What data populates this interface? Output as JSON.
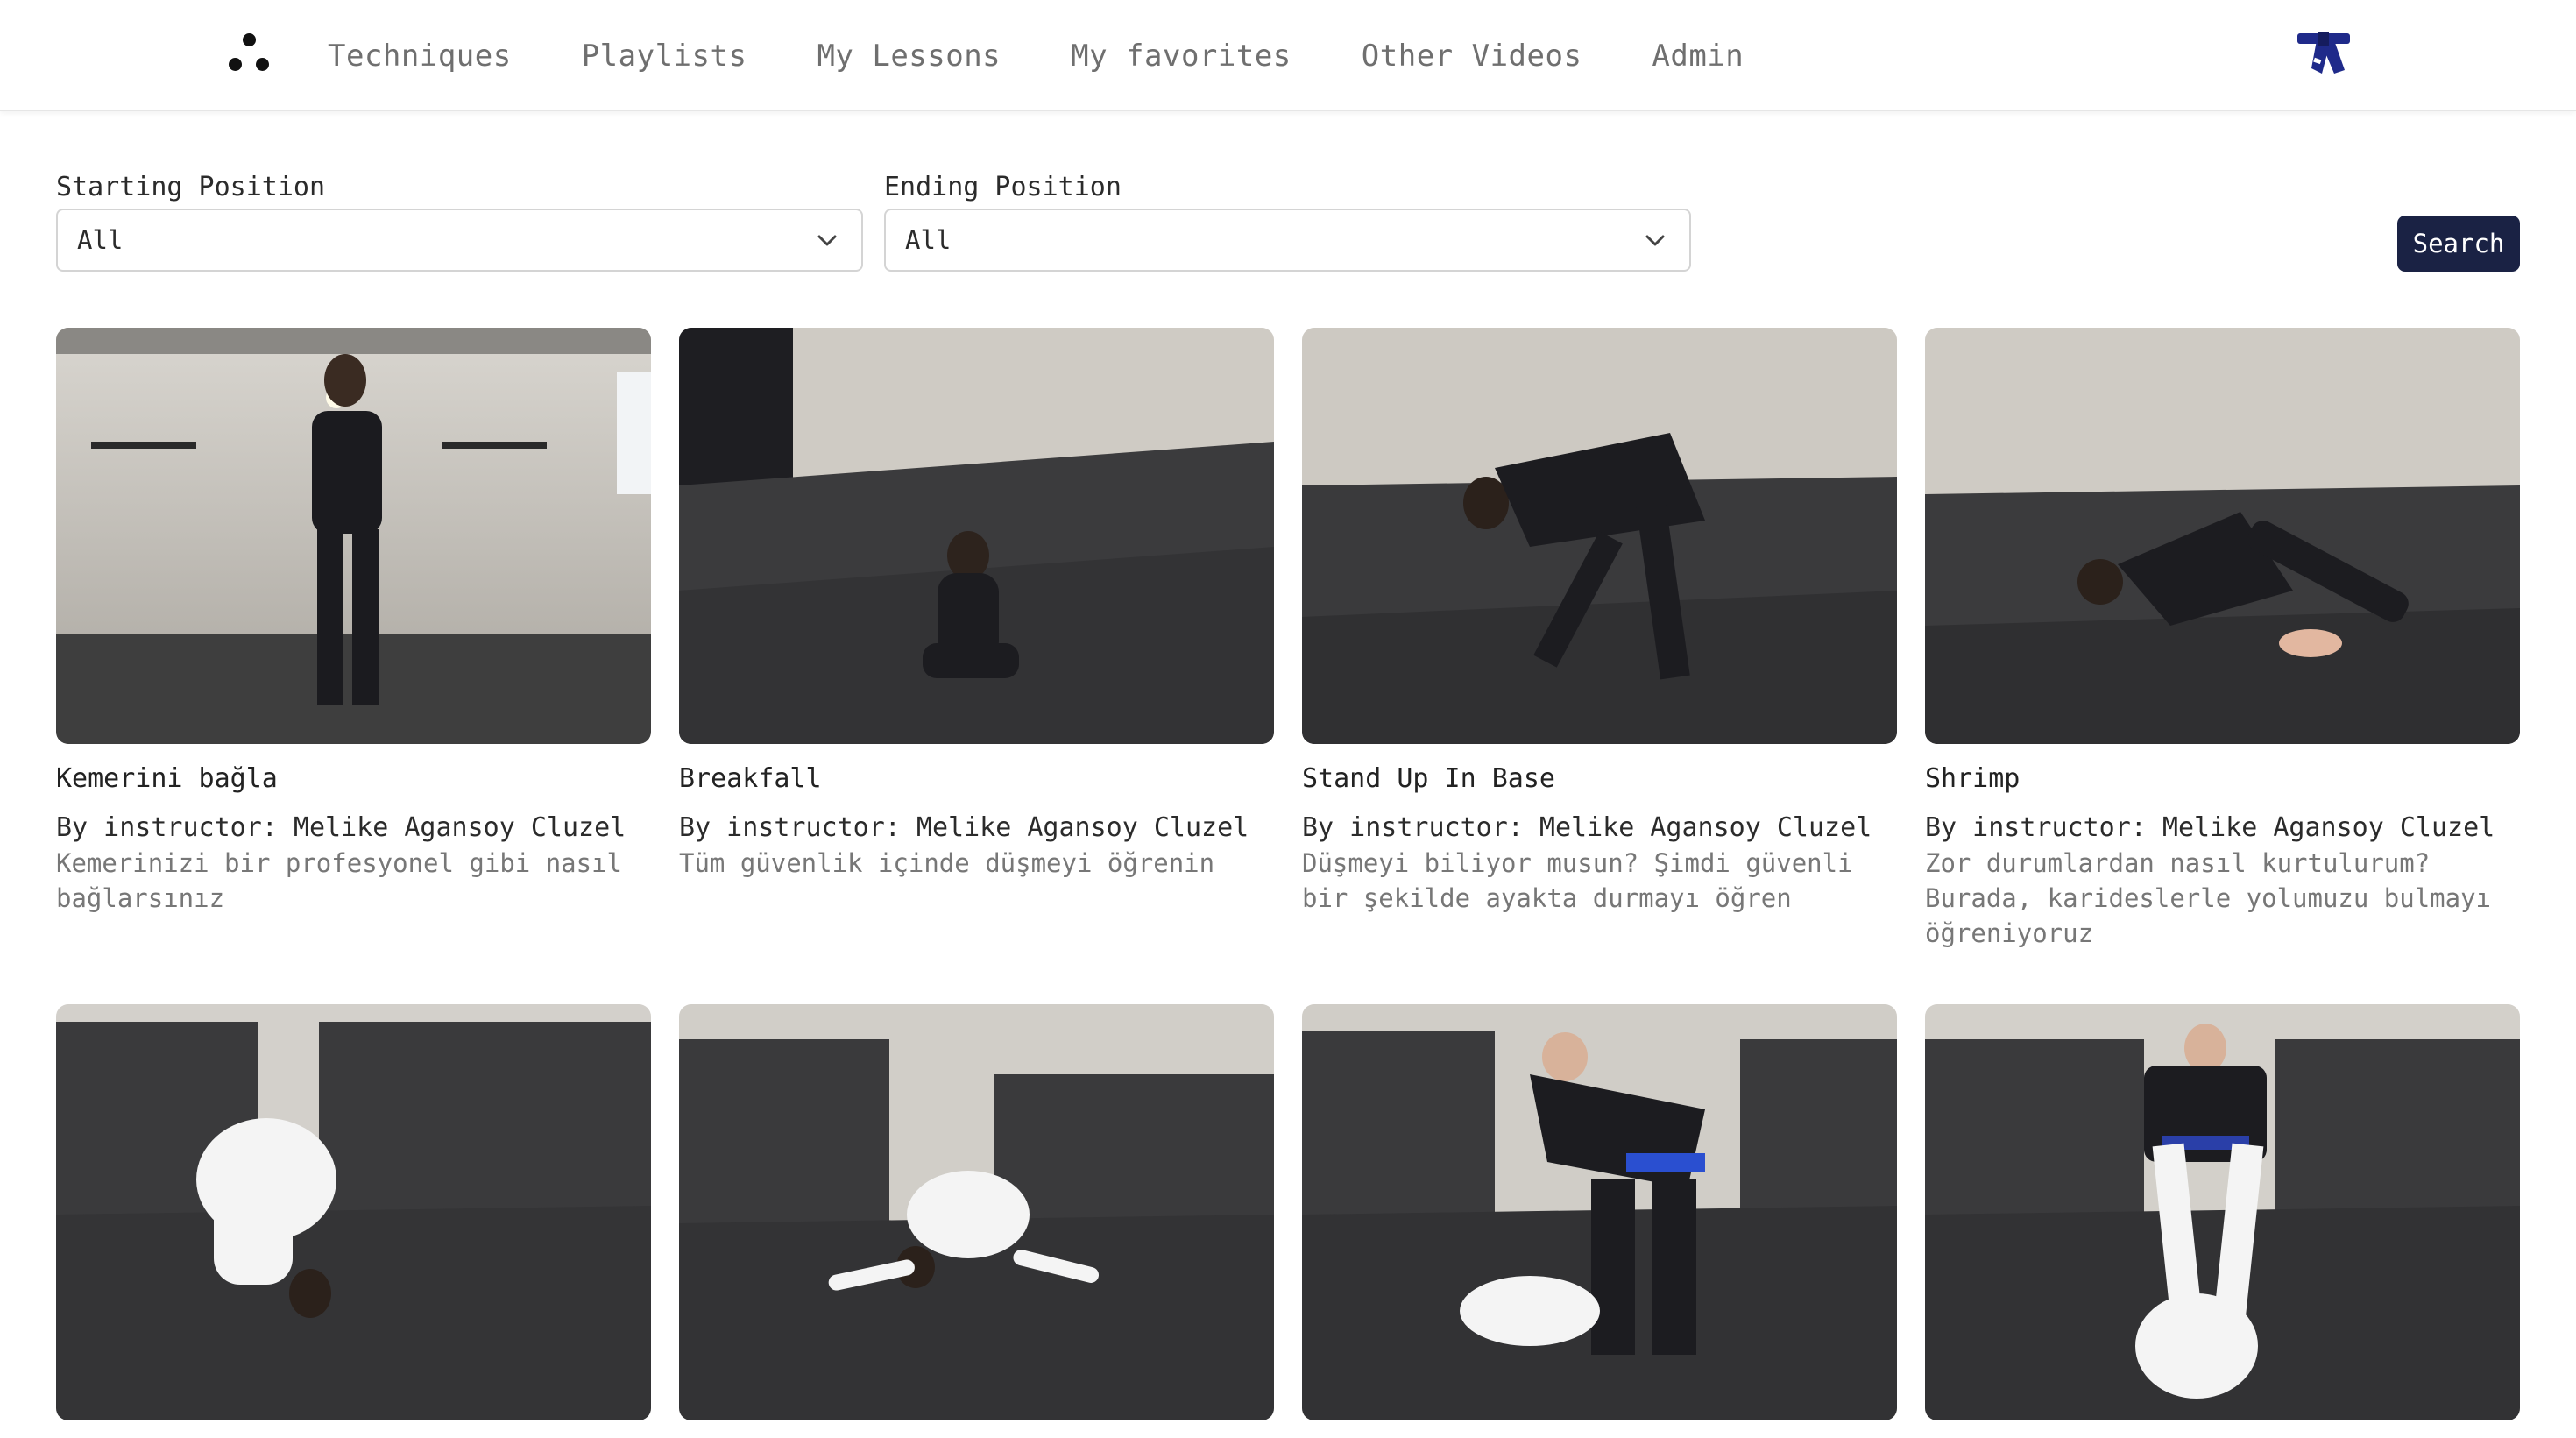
{
  "nav": {
    "items": [
      {
        "label": "Techniques"
      },
      {
        "label": "Playlists"
      },
      {
        "label": "My Lessons"
      },
      {
        "label": "My favorites"
      },
      {
        "label": "Other Videos"
      },
      {
        "label": "Admin"
      }
    ],
    "logo_icon": "three-dots-logo-icon",
    "profile_icon": "belt-icon",
    "belt_color": "#1f2a8a"
  },
  "filters": {
    "starting": {
      "label": "Starting Position",
      "value": "All"
    },
    "ending": {
      "label": "Ending Position",
      "value": "All"
    },
    "search_label": "Search",
    "accent": "#1a2244"
  },
  "videos": [
    {
      "title": "Kemerini bağla",
      "instructor": "By instructor: Melike Agansoy Cluzel",
      "description": "Kemerinizi bir profesyonel gibi nasıl bağlarsınız"
    },
    {
      "title": "Breakfall",
      "instructor": "By instructor: Melike Agansoy Cluzel",
      "description": "Tüm güvenlik içinde düşmeyi öğrenin"
    },
    {
      "title": "Stand Up In Base",
      "instructor": "By instructor: Melike Agansoy Cluzel",
      "description": "Düşmeyi biliyor musun? Şimdi güvenli bir şekilde ayakta durmayı öğren"
    },
    {
      "title": "Shrimp",
      "instructor": "By instructor: Melike Agansoy Cluzel",
      "description": "Zor durumlardan nasıl kurtulurum? Burada, karideslerle yolumuzu bulmayı öğreniyoruz"
    },
    {
      "title": "",
      "instructor": "",
      "description": ""
    },
    {
      "title": "",
      "instructor": "",
      "description": ""
    },
    {
      "title": "",
      "instructor": "",
      "description": ""
    },
    {
      "title": "",
      "instructor": "",
      "description": ""
    }
  ]
}
